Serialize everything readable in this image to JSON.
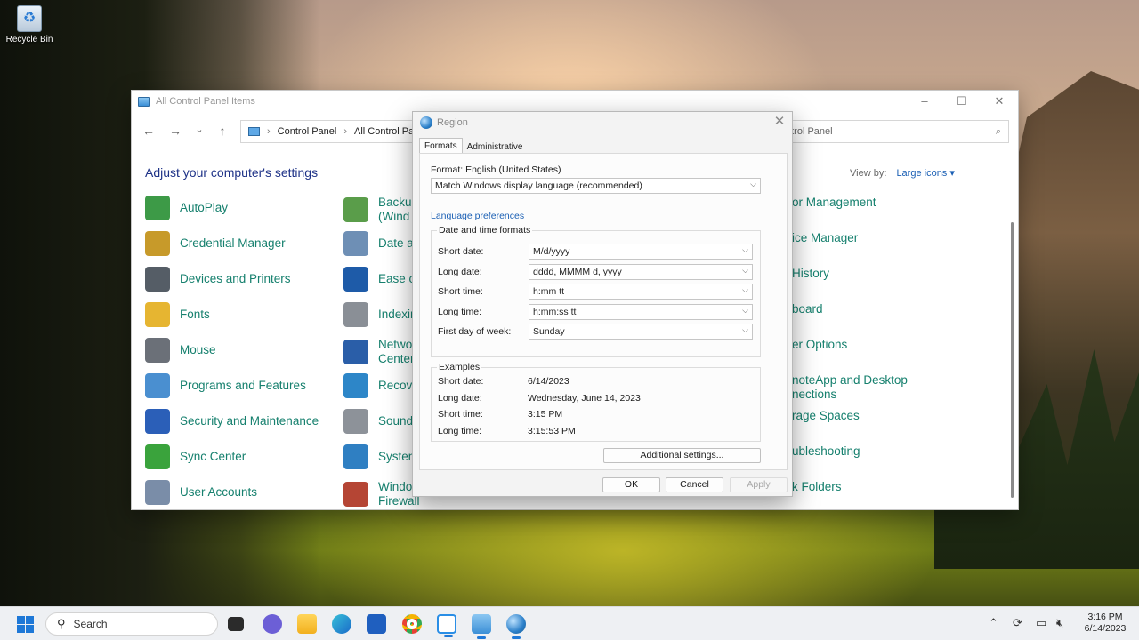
{
  "desktop": {
    "recycle_bin_label": "Recycle Bin"
  },
  "control_panel": {
    "title": "All Control Panel Items",
    "nav": {
      "back": "←",
      "forward": "→",
      "recent": "⌄",
      "up": "↑"
    },
    "address": {
      "part1": "Control Panel",
      "part2": "All Control Pa"
    },
    "search_text": "ntrol Panel",
    "heading": "Adjust your computer's settings",
    "view_by_label": "View by:",
    "view_by_value": "Large icons ▾",
    "items": [
      {
        "label": "AutoPlay",
        "icon": "autoplay-icon",
        "color": "#3d9a47"
      },
      {
        "label": "Credential Manager",
        "icon": "credential-manager-icon",
        "color": "#c79a2a"
      },
      {
        "label": "Devices and Printers",
        "icon": "printer-icon",
        "color": "#555d66"
      },
      {
        "label": "Fonts",
        "icon": "fonts-icon",
        "color": "#e6b531"
      },
      {
        "label": "Mouse",
        "icon": "mouse-icon",
        "color": "#6b7078"
      },
      {
        "label": "Programs and Features",
        "icon": "programs-icon",
        "color": "#4a8fd0"
      },
      {
        "label": "Security and Maintenance",
        "icon": "flag-icon",
        "color": "#2b5fb8"
      },
      {
        "label": "Sync Center",
        "icon": "sync-icon",
        "color": "#3aa33c"
      },
      {
        "label": "User Accounts",
        "icon": "users-icon",
        "color": "#7a8da8"
      },
      {
        "label": "Backup\n(Wind",
        "icon": "backup-icon",
        "color": "#5a9d4a"
      },
      {
        "label": "Date a",
        "icon": "calendar-clock-icon",
        "color": "#6e8fb5"
      },
      {
        "label": "Ease o",
        "icon": "ease-of-access-icon",
        "color": "#1e5ba8"
      },
      {
        "label": "Indexin",
        "icon": "indexing-icon",
        "color": "#8a8f96"
      },
      {
        "label": "Netwo\nCenter",
        "icon": "network-icon",
        "color": "#2a5ea8"
      },
      {
        "label": "Recove",
        "icon": "recovery-icon",
        "color": "#2d86c8"
      },
      {
        "label": "Sound",
        "icon": "speaker-icon",
        "color": "#8d9299"
      },
      {
        "label": "Systen",
        "icon": "system-icon",
        "color": "#2f7fc2"
      },
      {
        "label": "Windo\nFirewall",
        "icon": "firewall-icon",
        "color": "#b54534"
      },
      {
        "label": "or Management",
        "icon": "",
        "color": ""
      },
      {
        "label": "ice Manager",
        "icon": "",
        "color": ""
      },
      {
        "label": "History",
        "icon": "",
        "color": ""
      },
      {
        "label": "board",
        "icon": "",
        "color": ""
      },
      {
        "label": "er Options",
        "icon": "",
        "color": ""
      },
      {
        "label": "noteApp and Desktop\nnections",
        "icon": "",
        "color": ""
      },
      {
        "label": "rage Spaces",
        "icon": "",
        "color": ""
      },
      {
        "label": "ubleshooting",
        "icon": "",
        "color": ""
      },
      {
        "label": "k Folders",
        "icon": "",
        "color": ""
      }
    ]
  },
  "region_dialog": {
    "title": "Region",
    "tabs": [
      "Formats",
      "Administrative"
    ],
    "format_label": "Format: English (United States)",
    "format_value": "Match Windows display language (recommended)",
    "language_link": "Language preferences",
    "date_time_group": "Date and time formats",
    "fields": [
      {
        "label": "Short date:",
        "value": "M/d/yyyy"
      },
      {
        "label": "Long date:",
        "value": "dddd, MMMM d, yyyy"
      },
      {
        "label": "Short time:",
        "value": "h:mm tt"
      },
      {
        "label": "Long time:",
        "value": "h:mm:ss tt"
      },
      {
        "label": "First day of week:",
        "value": "Sunday"
      }
    ],
    "examples_group": "Examples",
    "examples": [
      {
        "label": "Short date:",
        "value": "6/14/2023"
      },
      {
        "label": "Long date:",
        "value": "Wednesday, June 14, 2023"
      },
      {
        "label": "Short time:",
        "value": "3:15 PM"
      },
      {
        "label": "Long time:",
        "value": "3:15:53 PM"
      }
    ],
    "additional_settings": "Additional settings...",
    "ok": "OK",
    "cancel": "Cancel",
    "apply": "Apply"
  },
  "taskbar": {
    "search_placeholder": "Search",
    "time": "3:16 PM",
    "date": "6/14/2023",
    "apps": [
      "task-view-icon",
      "chat-icon",
      "file-explorer-icon",
      "edge-icon",
      "store-icon",
      "chrome-icon",
      "snipping-tool-icon",
      "control-panel-icon",
      "region-icon"
    ]
  }
}
